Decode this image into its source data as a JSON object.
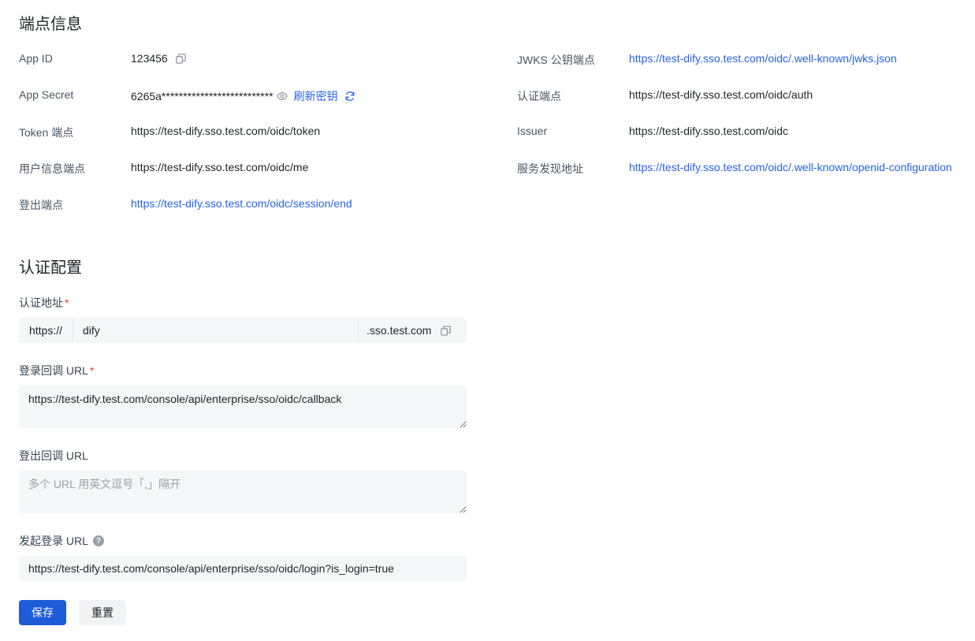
{
  "endpoint_section": {
    "title": "端点信息"
  },
  "left_info": [
    {
      "label": "App ID",
      "value": "123456",
      "type": "copy"
    },
    {
      "label": "App Secret",
      "value": "6265a**************************",
      "type": "secret",
      "refresh_label": "刷新密钥"
    },
    {
      "label": "Token 端点",
      "value": "https://test-dify.sso.test.com/oidc/token",
      "type": "text"
    },
    {
      "label": "用户信息端点",
      "value": "https://test-dify.sso.test.com/oidc/me",
      "type": "text"
    },
    {
      "label": "登出端点",
      "value": "https://test-dify.sso.test.com/oidc/session/end",
      "type": "link"
    }
  ],
  "right_info": [
    {
      "label": "JWKS 公钥端点",
      "value": "https://test-dify.sso.test.com/oidc/.well-known/jwks.json",
      "type": "link"
    },
    {
      "label": "认证端点",
      "value": "https://test-dify.sso.test.com/oidc/auth",
      "type": "text"
    },
    {
      "label": "Issuer",
      "value": "https://test-dify.sso.test.com/oidc",
      "type": "text"
    },
    {
      "label": "服务发现地址",
      "value": "https://test-dify.sso.test.com/oidc/.well-known/openid-configuration",
      "type": "link"
    }
  ],
  "auth_section": {
    "title": "认证配置"
  },
  "auth_address": {
    "label": "认证地址",
    "required_mark": "*",
    "prefix": "https://",
    "value": "dify",
    "suffix": ".sso.test.com"
  },
  "login_callback": {
    "label": "登录回调 URL",
    "required_mark": "*",
    "value": "https://test-dify.test.com/console/api/enterprise/sso/oidc/callback"
  },
  "logout_callback": {
    "label": "登出回调 URL",
    "placeholder": "多个 URL 用英文逗号「,」隔开",
    "value": ""
  },
  "initiate_login": {
    "label": "发起登录 URL",
    "help": "?",
    "value": "https://test-dify.test.com/console/api/enterprise/sso/oidc/login?is_login=true"
  },
  "actions": {
    "save_label": "保存",
    "reset_label": "重置"
  },
  "colors": {
    "link": "#2563eb",
    "primary": "#1d5bd8",
    "required": "#e53935",
    "field_bg": "#f5f6f8"
  }
}
